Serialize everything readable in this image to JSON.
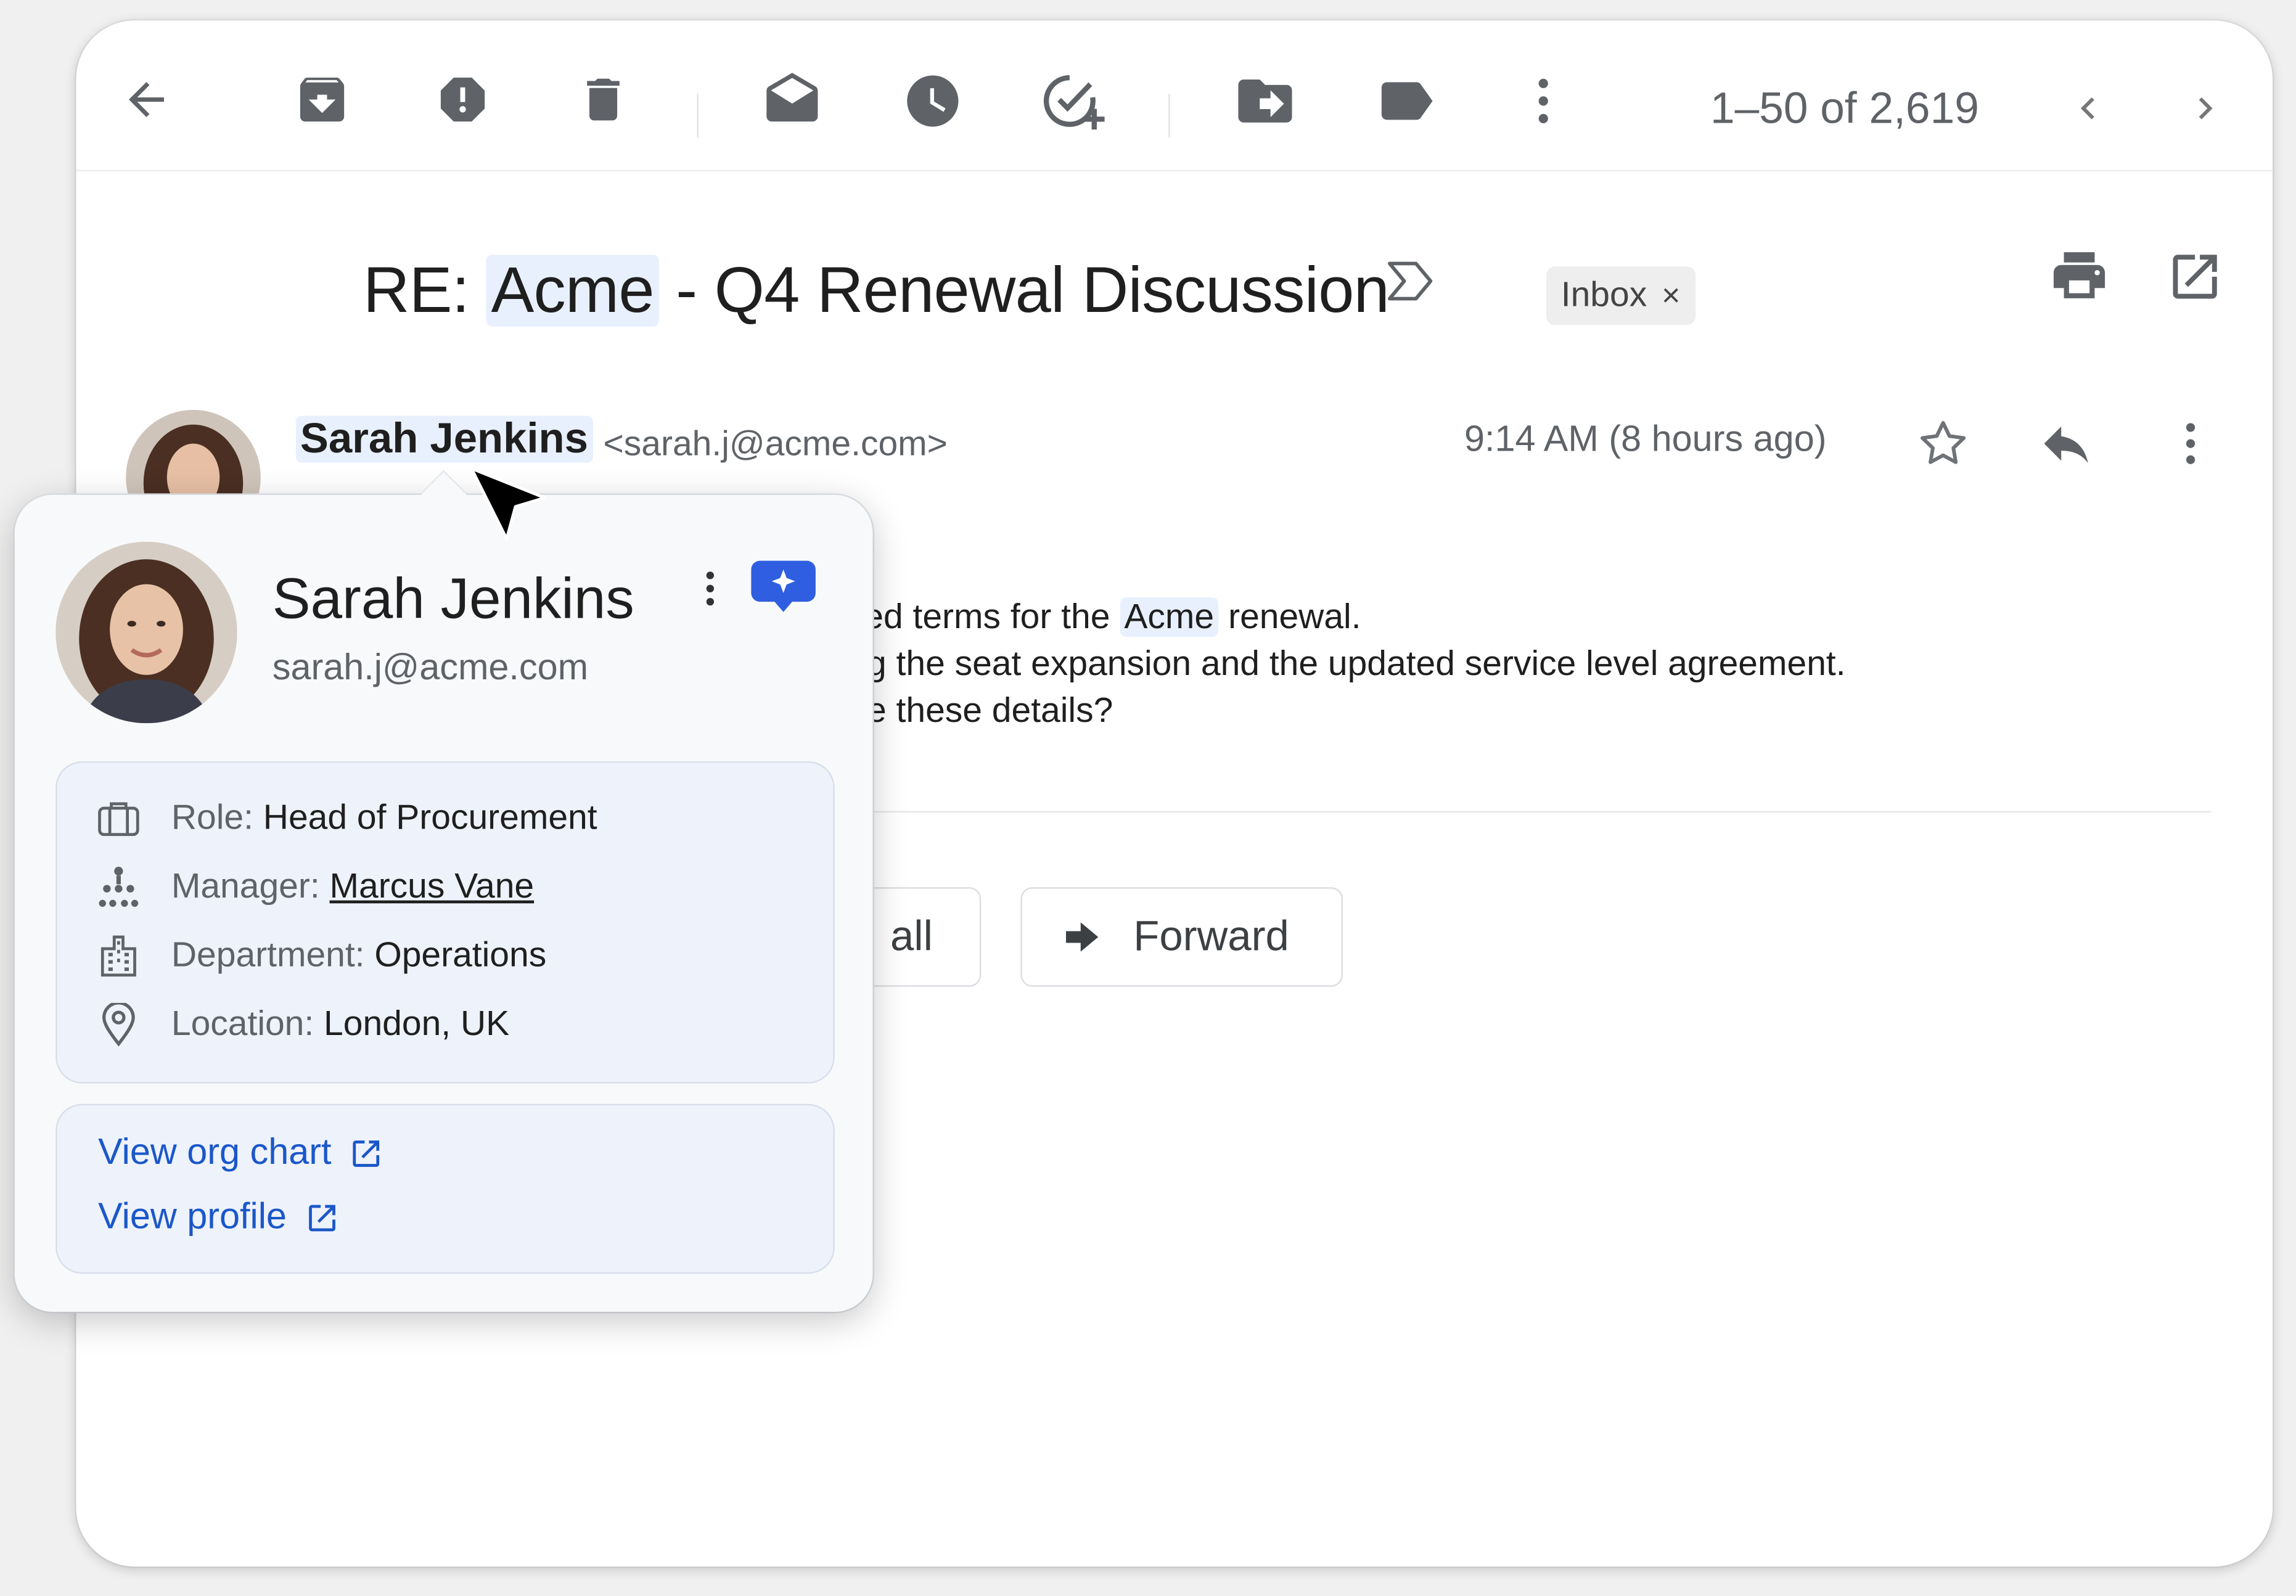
{
  "toolbar": {
    "pagination": "1–50 of 2,619",
    "icons": [
      "back-arrow-icon",
      "archive-icon",
      "report-spam-icon",
      "delete-icon",
      "mark-unread-icon",
      "snooze-icon",
      "add-to-tasks-icon",
      "move-to-icon",
      "label-icon",
      "more-vert-icon",
      "chevron-left-icon",
      "chevron-right-icon"
    ]
  },
  "email": {
    "subject_prefix": "RE: ",
    "subject_company": "Acme",
    "subject_rest": " - Q4 Renewal Discussion",
    "label_chip": "Inbox",
    "label_remove": "×",
    "sender_name": "Sarah Jenkins",
    "sender_email": "<sarah.j@acme.com>",
    "time": "9:14 AM (8 hours ago)",
    "body_line1_a": "ed terms for the ",
    "body_line1_company": "Acme",
    "body_line1_b": " renewal.",
    "body_line2": "g the seat expansion and the updated service level agreement.",
    "body_line3": "e these details?",
    "reply_all_partial": "all",
    "forward_label": "Forward"
  },
  "contact_card": {
    "name": "Sarah Jenkins",
    "email": "sarah.j@acme.com",
    "details": [
      {
        "key": "Role:",
        "value": "Head of Procurement",
        "icon": "briefcase-icon"
      },
      {
        "key": "Manager:",
        "value": "Marcus Vane",
        "icon": "org-tree-icon"
      },
      {
        "key": "Department:",
        "value": "Operations",
        "icon": "building-icon"
      },
      {
        "key": "Location:",
        "value": "London, UK",
        "icon": "location-pin-icon"
      }
    ],
    "links": [
      {
        "label": "View org chart",
        "icon": "external-link-icon"
      },
      {
        "label": "View profile",
        "icon": "external-link-icon"
      }
    ]
  },
  "colors": {
    "accent_blue": "#1a57c9",
    "highlight": "#e8f0fe",
    "ai_button": "#2f5fe0"
  }
}
